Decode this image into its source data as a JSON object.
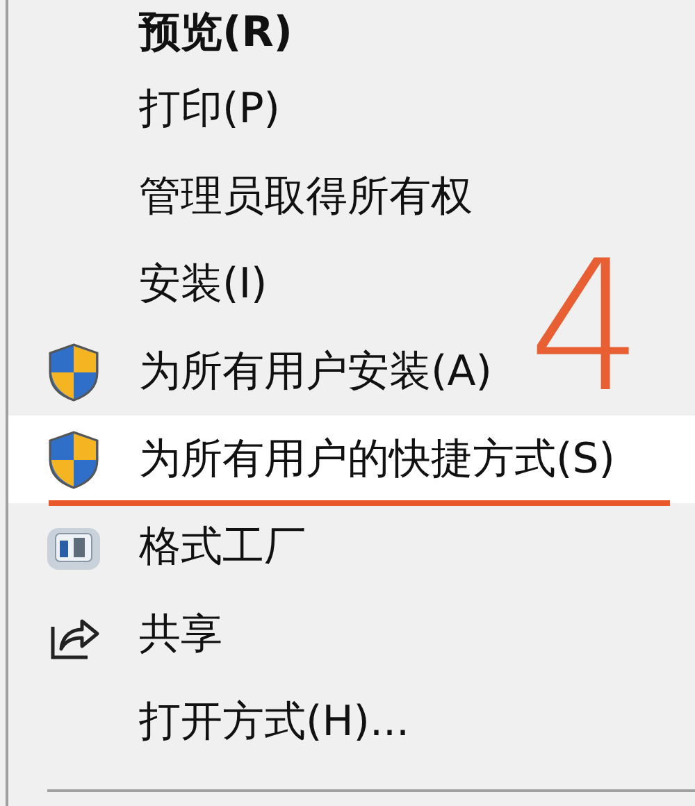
{
  "menu": {
    "items": [
      {
        "label": "预览(R)",
        "kind": "plain",
        "default": true,
        "selected": false
      },
      {
        "label": "打印(P)",
        "kind": "plain",
        "default": false,
        "selected": false
      },
      {
        "label": "管理员取得所有权",
        "kind": "plain",
        "default": false,
        "selected": false
      },
      {
        "label": "安装(I)",
        "kind": "plain",
        "default": false,
        "selected": false
      },
      {
        "label": "为所有用户安装(A)",
        "kind": "admin",
        "default": false,
        "selected": false
      },
      {
        "label": "为所有用户的快捷方式(S)",
        "kind": "admin",
        "default": false,
        "selected": true
      },
      {
        "label": "格式工厂",
        "kind": "app",
        "default": false,
        "selected": false
      },
      {
        "label": "共享",
        "kind": "share",
        "default": false,
        "selected": false
      },
      {
        "label": "打开方式(H)...",
        "kind": "plain",
        "default": false,
        "selected": false
      }
    ]
  },
  "annotation": {
    "mark": "4"
  }
}
